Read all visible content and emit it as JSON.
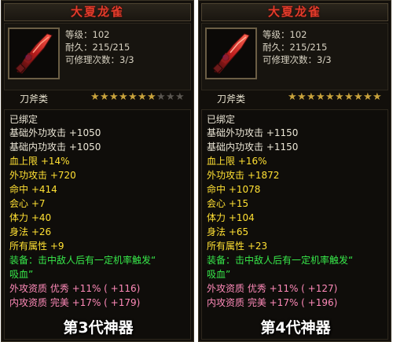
{
  "panels": [
    {
      "item_name": "大夏龙雀",
      "level": "等级：102",
      "durability": "耐久：215/215",
      "repairs": "可修理次数：3/3",
      "category": "刀斧类",
      "stars_filled": 7,
      "stars_total": 10,
      "bound": "已绑定",
      "attrs": [
        {
          "text": "基础外功攻击 +1050",
          "color": "white"
        },
        {
          "text": "基础内功攻击 +1050",
          "color": "white"
        },
        {
          "text": "血上限 +14%",
          "color": "yellow"
        },
        {
          "text": "外功攻击 +720",
          "color": "yellow"
        },
        {
          "text": "命中 +414",
          "color": "yellow"
        },
        {
          "text": "会心 +7",
          "color": "yellow"
        },
        {
          "text": "体力 +40",
          "color": "yellow"
        },
        {
          "text": "身法 +26",
          "color": "yellow"
        },
        {
          "text": "所有属性 +9",
          "color": "yellow"
        }
      ],
      "equip_line1": "装备：击中敌人后有一定机率触发“",
      "equip_line2": "吸血”",
      "quality": [
        {
          "text": "外攻资质  优秀 +11% ( +116)",
          "color": "pink"
        },
        {
          "text": "内攻资质  完美 +17% ( +179)",
          "color": "pink"
        }
      ],
      "generation_label": "第3代神器"
    },
    {
      "item_name": "大夏龙雀",
      "level": "等级：102",
      "durability": "耐久：215/215",
      "repairs": "可修理次数：3/3",
      "category": "刀斧类",
      "stars_filled": 10,
      "stars_total": 10,
      "bound": "已绑定",
      "attrs": [
        {
          "text": "基础外功攻击 +1150",
          "color": "white"
        },
        {
          "text": "基础内功攻击 +1150",
          "color": "white"
        },
        {
          "text": "血上限 +16%",
          "color": "yellow"
        },
        {
          "text": "外功攻击 +1872",
          "color": "yellow"
        },
        {
          "text": "命中 +1078",
          "color": "yellow"
        },
        {
          "text": "会心 +15",
          "color": "yellow"
        },
        {
          "text": "体力 +104",
          "color": "yellow"
        },
        {
          "text": "身法 +65",
          "color": "yellow"
        },
        {
          "text": "所有属性 +23",
          "color": "yellow"
        }
      ],
      "equip_line1": "装备：击中敌人后有一定机率触发“",
      "equip_line2": "吸血”",
      "quality": [
        {
          "text": "外攻资质  优秀 +11% ( +127)",
          "color": "pink"
        },
        {
          "text": "内攻资质  完美 +17% ( +196)",
          "color": "pink"
        }
      ],
      "generation_label": "第4代神器"
    }
  ],
  "colors": {
    "white": "#ebe6d6",
    "yellow": "#ffe033",
    "green": "#37e84a",
    "pink": "#ff8ab9",
    "title_red": "#e23c2b",
    "star_gold": "#c9a33c",
    "star_dim": "#5a5650"
  },
  "icons": {
    "item_icon": "red-blade-icon",
    "star_icon": "star-icon"
  }
}
